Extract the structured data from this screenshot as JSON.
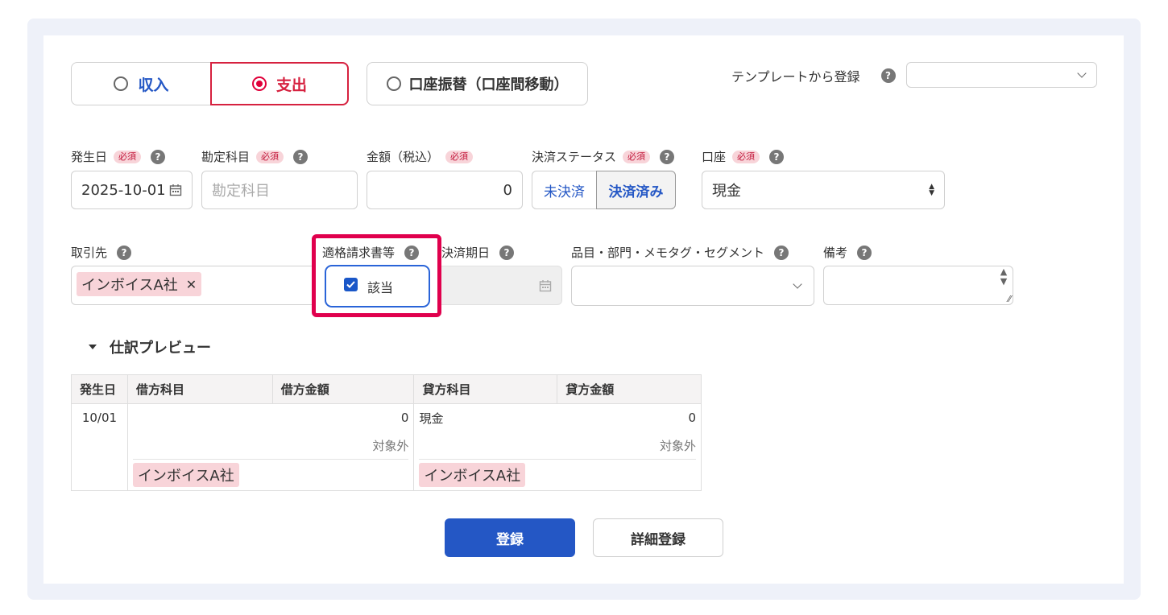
{
  "type_toggle": {
    "income": "収入",
    "expense": "支出",
    "transfer": "口座振替（口座間移動）",
    "selected": "expense"
  },
  "template": {
    "label": "テンプレートから登録",
    "value": ""
  },
  "required_tag": "必須",
  "help_glyph": "?",
  "fields": {
    "date": {
      "label": "発生日",
      "value": "2025-10-01"
    },
    "account_item": {
      "label": "勘定科目",
      "placeholder": "勘定科目"
    },
    "amount": {
      "label": "金額（税込）",
      "value": "0"
    },
    "settlement": {
      "label": "決済ステータス",
      "unsettled": "未決済",
      "settled": "決済済み",
      "selected": "settled"
    },
    "wallet": {
      "label": "口座",
      "value": "現金"
    },
    "partner": {
      "label": "取引先",
      "chip": "インボイスA社",
      "remove": "✕"
    },
    "invoice": {
      "label": "適格請求書等",
      "checkbox_label": "該当",
      "checked": true
    },
    "due_date": {
      "label": "決済期日"
    },
    "tags": {
      "label": "品目・部門・メモタグ・セグメント"
    },
    "memo": {
      "label": "備考"
    }
  },
  "preview": {
    "title": "仕訳プレビュー",
    "headers": [
      "発生日",
      "借方科目",
      "借方金額",
      "貸方科目",
      "貸方金額"
    ],
    "row": {
      "date": "10/01",
      "debit_account": "",
      "debit_amount": "0",
      "debit_tax": "対象外",
      "debit_partner": "インボイスA社",
      "credit_account": "現金",
      "credit_amount": "0",
      "credit_tax": "対象外",
      "credit_partner": "インボイスA社"
    }
  },
  "buttons": {
    "register": "登録",
    "detail_register": "詳細登録"
  },
  "colors": {
    "primary": "#2457c5",
    "accent_red": "#e0003a",
    "highlight": "#e0004d",
    "tag_pink": "#f8d4d9"
  }
}
